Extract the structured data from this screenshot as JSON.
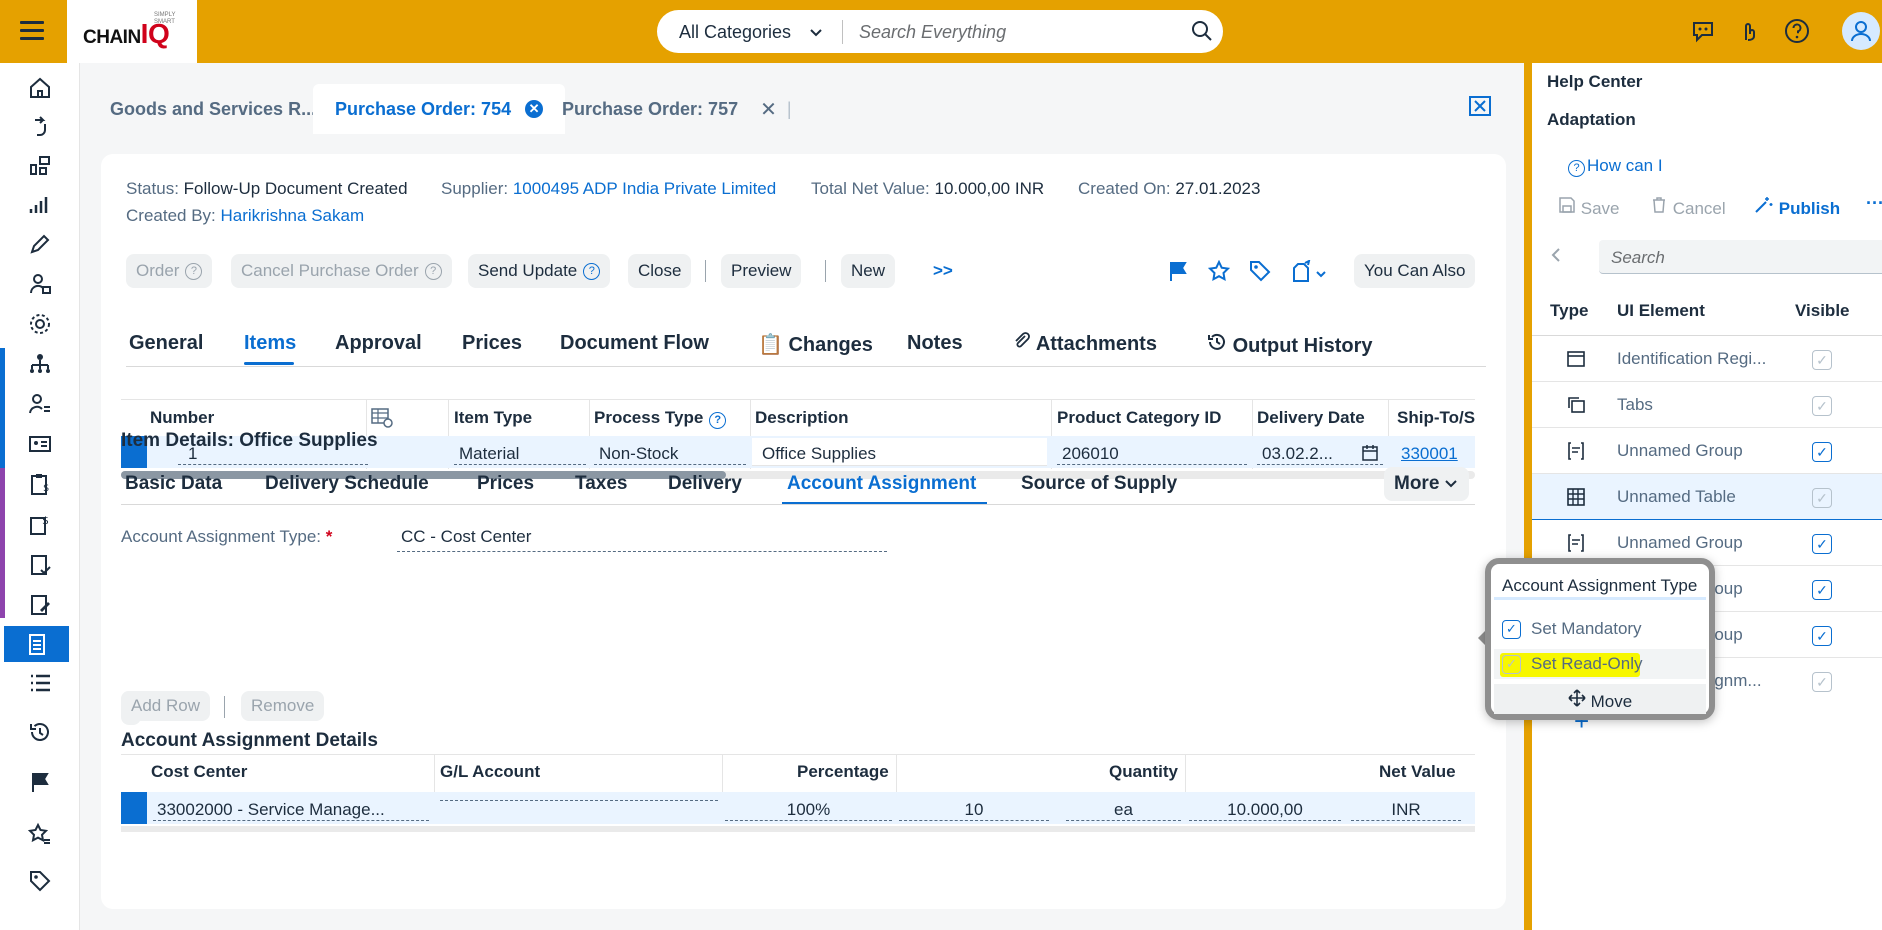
{
  "header": {
    "logo_text": "CHAIN",
    "logo_q": "IQ",
    "logo_tagline": "SIMPLY SMART",
    "search_category": "All Categories",
    "search_placeholder": "Search Everything"
  },
  "doc_tabs": [
    {
      "label": "Goods and Services R..."
    },
    {
      "label": "Purchase Order: 754"
    },
    {
      "label": "Purchase Order: 757"
    }
  ],
  "object_header": {
    "status_label": "Status:",
    "status_value": "Follow-Up Document Created",
    "supplier_label": "Supplier:",
    "supplier_value": "1000495 ADP India Private Limited",
    "net_label": "Total Net Value:",
    "net_value": "10.000,00 INR",
    "created_on_label": "Created On:",
    "created_on_value": "27.01.2023",
    "created_by_label": "Created By:",
    "created_by_value": "Harikrishna Sakam"
  },
  "toolbar": {
    "order": "Order",
    "cancel_po": "Cancel Purchase Order",
    "send_update": "Send Update",
    "close": "Close",
    "preview": "Preview",
    "new": "New",
    "overflow": ">>",
    "you_can_also": "You Can Also"
  },
  "section_tabs": [
    {
      "label": "General"
    },
    {
      "label": "Items"
    },
    {
      "label": "Approval"
    },
    {
      "label": "Prices"
    },
    {
      "label": "Document Flow"
    },
    {
      "label": "Changes"
    },
    {
      "label": "Notes"
    },
    {
      "label": "Attachments"
    },
    {
      "label": "Output History"
    }
  ],
  "items_table": {
    "headers": [
      "Number",
      "Item Type",
      "Process Type",
      "Description",
      "Product Category ID",
      "Delivery Date",
      "Ship-To/S"
    ],
    "row": {
      "number": "1",
      "item_type": "Material",
      "process_type": "Non-Stock",
      "description": "Office Supplies",
      "product_category": "206010",
      "delivery_date": "03.02.2...",
      "ship_to": "330001"
    }
  },
  "item_details": {
    "title": "Item Details: Office Supplies",
    "tabs": [
      {
        "label": "Basic Data"
      },
      {
        "label": "Delivery Schedule"
      },
      {
        "label": "Prices"
      },
      {
        "label": "Taxes"
      },
      {
        "label": "Delivery"
      },
      {
        "label": "Account Assignment"
      },
      {
        "label": "Source of Supply"
      }
    ],
    "more": "More",
    "aat_label": "Account Assignment Type:",
    "aat_required": "*",
    "aat_value": "CC - Cost Center",
    "add_row": "Add Row",
    "remove": "Remove",
    "details_title": "Account Assignment Details",
    "details_headers": [
      "Cost Center",
      "G/L Account",
      "Percentage",
      "Quantity",
      "Net Value"
    ],
    "details_row": {
      "cost_center": "33002000 - Service Manage...",
      "percentage": "100%",
      "quantity": "10",
      "unit": "ea",
      "net_value": "10.000,00",
      "currency": "INR"
    }
  },
  "right_panel": {
    "help_center": "Help Center",
    "adaptation": "Adaptation",
    "how_can_i": "How can I",
    "save": "Save",
    "cancel": "Cancel",
    "publish": "Publish",
    "search_placeholder": "Search",
    "col_type": "Type",
    "col_ui_element": "UI Element",
    "col_visible": "Visible",
    "rows": [
      {
        "label": "Identification Regi...",
        "icon": "header-region-icon"
      },
      {
        "label": "Tabs",
        "icon": "tabs-icon"
      },
      {
        "label": "Unnamed Group",
        "icon": "group-icon"
      },
      {
        "label": "Unnamed Table",
        "icon": "table-icon"
      },
      {
        "label": "Unnamed Group",
        "icon": "group-icon"
      },
      {
        "label": "Unnamed Group",
        "icon": "group-icon"
      },
      {
        "label": "Unnamed Group",
        "icon": "group-icon"
      },
      {
        "label": "Account Assignm...",
        "icon": "group-icon"
      }
    ]
  },
  "popover": {
    "title": "Account Assignment Type",
    "set_mandatory": "Set Mandatory",
    "set_read_only": "Set Read-Only",
    "move": "Move"
  },
  "colors": {
    "brand": "#e5a100",
    "accent": "#0a6ed1",
    "highlight": "#f7f700"
  }
}
